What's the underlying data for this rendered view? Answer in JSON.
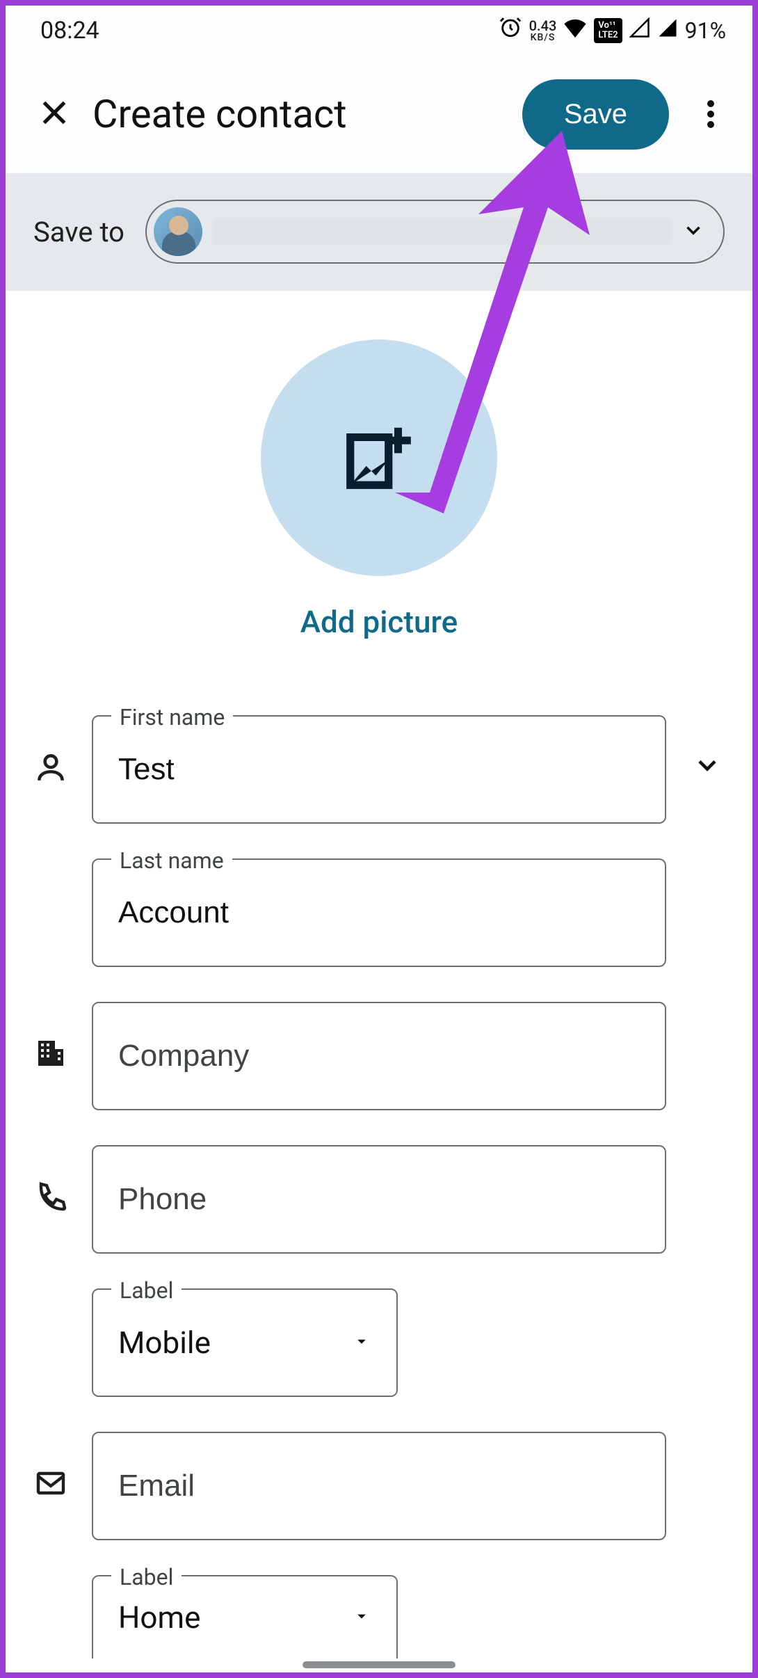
{
  "statusbar": {
    "time": "08:24",
    "data_rate": "0.43",
    "data_unit": "KB/S",
    "lte_badge": "Vo 1\nLTE 2",
    "battery_pct": "91%"
  },
  "appbar": {
    "title": "Create contact",
    "save_label": "Save"
  },
  "saveto": {
    "label": "Save to"
  },
  "picture": {
    "add_label": "Add picture"
  },
  "fields": {
    "first_name_label": "First name",
    "first_name_value": "Test",
    "last_name_label": "Last name",
    "last_name_value": "Account",
    "company_placeholder": "Company",
    "phone_placeholder": "Phone",
    "phone_label_label": "Label",
    "phone_label_value": "Mobile",
    "email_placeholder": "Email",
    "email_label_label": "Label",
    "email_label_value": "Home"
  }
}
